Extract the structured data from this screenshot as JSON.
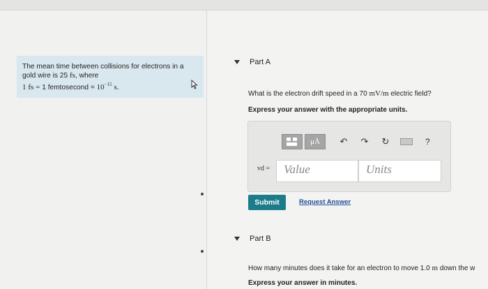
{
  "problem": {
    "line1": "The mean time between collisions for electrons in a",
    "line2_pre": "gold wire is 25",
    "line2_unit": "fs",
    "line2_post": ", where",
    "line3_a": "1",
    "line3_unit": "fs",
    "line3_eq": "=",
    "line3_text": "1 femtosecond =",
    "line3_base": "10",
    "line3_exp": "−15",
    "line3_end": "s."
  },
  "part_a": {
    "label": "Part A",
    "question_pre": "What is the electron drift speed in a 70",
    "question_unit": "mV/m",
    "question_post": "electric field?",
    "instruction": "Express your answer with the appropriate units.",
    "toolbar": {
      "greek_label": "μÅ",
      "undo_icon": "undo-arrow-icon",
      "redo_icon": "redo-arrow-icon",
      "reset_icon": "reset-icon",
      "keyboard_icon": "keyboard-icon",
      "help_label": "?"
    },
    "var_label": "vd =",
    "value_placeholder": "Value",
    "units_placeholder": "Units",
    "submit_label": "Submit",
    "request_label": "Request Answer"
  },
  "part_b": {
    "label": "Part B",
    "question_pre": "How many minutes does it take for an electron to move 1.0",
    "question_unit": "m",
    "question_post": "down the w",
    "instruction": "Express your answer in minutes."
  },
  "colors": {
    "problem_bg": "#d9e8ef",
    "submit_bg": "#1d7c8b",
    "link": "#1f4e9c"
  }
}
